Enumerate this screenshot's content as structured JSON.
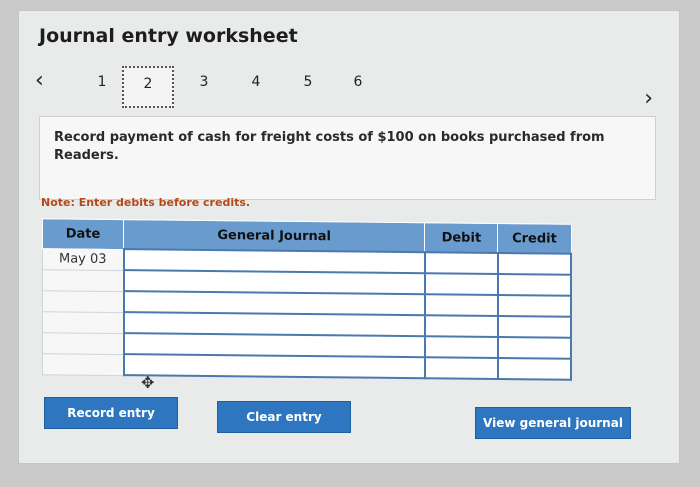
{
  "header": {
    "title": "Journal entry worksheet"
  },
  "pager": {
    "prev_icon": "chevron-left-icon",
    "next_icon": "chevron-right-icon",
    "steps": [
      "1",
      "2",
      "3",
      "4",
      "5",
      "6"
    ],
    "active_step": "2"
  },
  "description": "Record payment of cash for freight costs of $100 on books purchased from Readers.",
  "note": "Note: Enter debits before credits.",
  "table": {
    "columns": [
      "Date",
      "General Journal",
      "Debit",
      "Credit"
    ],
    "rows": [
      {
        "date": "May 03",
        "account": "",
        "debit": "",
        "credit": ""
      },
      {
        "date": "",
        "account": "",
        "debit": "",
        "credit": ""
      },
      {
        "date": "",
        "account": "",
        "debit": "",
        "credit": ""
      },
      {
        "date": "",
        "account": "",
        "debit": "",
        "credit": ""
      },
      {
        "date": "",
        "account": "",
        "debit": "",
        "credit": ""
      },
      {
        "date": "",
        "account": "",
        "debit": "",
        "credit": ""
      }
    ]
  },
  "buttons": {
    "record": "Record entry",
    "clear": "Clear entry",
    "view": "View general journal"
  },
  "colors": {
    "header_blue": "#6a9bcf",
    "button_blue": "#2e77c0",
    "note_orange": "#b34a1a"
  }
}
